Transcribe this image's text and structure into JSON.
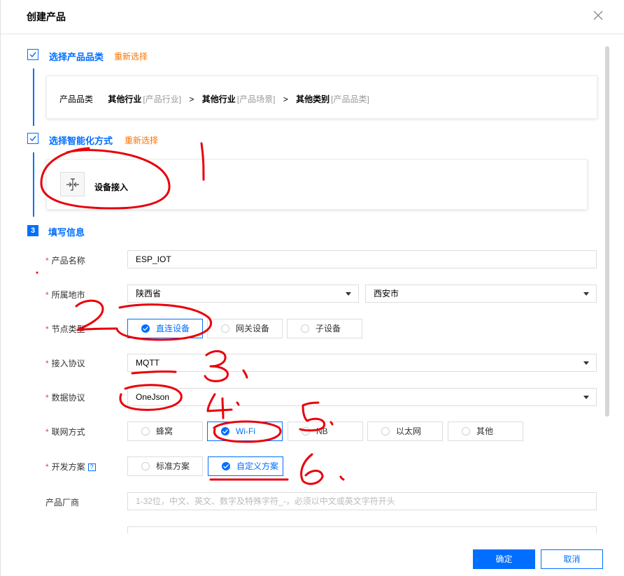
{
  "dialog": {
    "title": "创建产品"
  },
  "step1": {
    "title": "选择产品品类",
    "reselect": "重新选择",
    "label": "产品品类",
    "crumbs": [
      {
        "name": "其他行业",
        "type": "[产品行业]"
      },
      {
        "name": "其他行业",
        "type": "[产品场景]"
      },
      {
        "name": "其他类别",
        "type": "[产品品类]"
      }
    ],
    "separator": ">"
  },
  "step2": {
    "title": "选择智能化方式",
    "reselect": "重新选择",
    "method": "设备接入",
    "method_icon": "device-access-icon"
  },
  "step3": {
    "number": "3",
    "title": "填写信息"
  },
  "form": {
    "product_name": {
      "label": "产品名称",
      "value": "ESP_IOT"
    },
    "region": {
      "label": "所属地市",
      "province": "陕西省",
      "city": "西安市"
    },
    "node_type": {
      "label": "节点类型",
      "options": [
        "直连设备",
        "网关设备",
        "子设备"
      ],
      "selected": 0
    },
    "protocol": {
      "label": "接入协议",
      "value": "MQTT"
    },
    "data_protocol": {
      "label": "数据协议",
      "value": "OneJson"
    },
    "network": {
      "label": "联网方式",
      "options": [
        "蜂窝",
        "Wi-Fi",
        "NB",
        "以太网",
        "其他"
      ],
      "selected": 1
    },
    "dev_plan": {
      "label": "开发方案",
      "help": "?",
      "options": [
        "标准方案",
        "自定义方案"
      ],
      "selected": 1
    },
    "vendor": {
      "label": "产品厂商",
      "placeholder": "1-32位，中文、英文、数字及特殊字符_-，必须以中文或英文字符开头"
    }
  },
  "footer": {
    "confirm": "确定",
    "cancel": "取消"
  },
  "colors": {
    "accent": "#006eff",
    "link": "#ff7200",
    "required": "#e54545",
    "annotation": "#e8000b"
  },
  "annotations": [
    "1",
    "2",
    "3.",
    "4.",
    "5.",
    "6."
  ]
}
